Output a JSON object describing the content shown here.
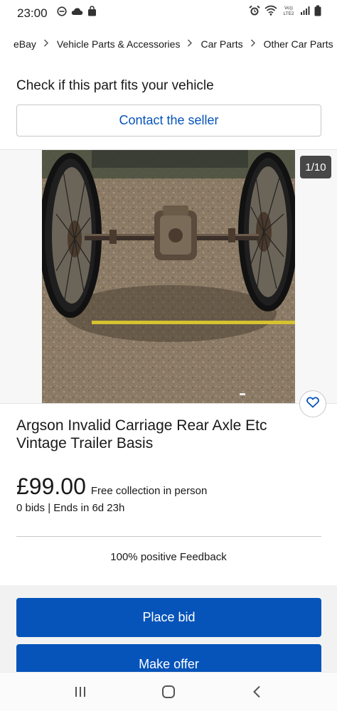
{
  "status_bar": {
    "time": "23:00",
    "network_label": "Vo))\nLTE2",
    "icons_left": [
      "do-not-disturb-icon",
      "cloud-icon",
      "shopping-bag-icon"
    ],
    "icons_right": [
      "alarm-icon",
      "wifi-icon",
      "signal-icon",
      "battery-icon"
    ]
  },
  "breadcrumb": [
    "eBay",
    "Vehicle Parts & Accessories",
    "Car Parts",
    "Other Car Parts"
  ],
  "fitment": {
    "title": "Check if this part fits your vehicle",
    "contact_label": "Contact the seller"
  },
  "gallery": {
    "counter": "1/10",
    "image_alt": "Rear axle with two spoked wheels lying on gravel next to a tape measure"
  },
  "item": {
    "title": "Argson Invalid Carriage Rear Axle Etc Vintage Trailer Basis",
    "price": "£99.00",
    "collection": "Free collection in person",
    "bids": "0 bids | Ends in 6d 23h",
    "feedback": "100% positive Feedback"
  },
  "actions": {
    "place_bid": "Place bid",
    "make_offer": "Make offer"
  },
  "colors": {
    "primary": "#0654ba",
    "link": "#0654ba",
    "text": "#191919"
  },
  "nav": [
    "recent-apps-icon",
    "home-icon",
    "back-icon"
  ]
}
